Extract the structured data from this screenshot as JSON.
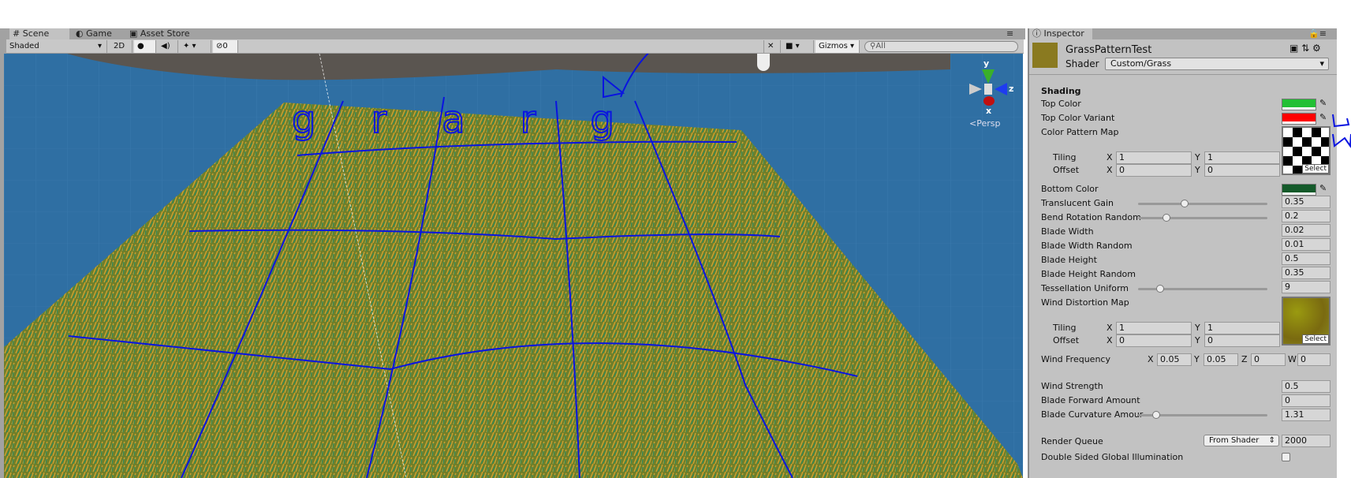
{
  "tabs": [
    {
      "label": "Scene",
      "icon": "grid-icon"
    },
    {
      "label": "Game",
      "icon": "pacman-icon"
    },
    {
      "label": "Asset Store",
      "icon": "bag-icon"
    }
  ],
  "scene_toolbar": {
    "shading_mode": "Shaded",
    "mode_2d": "2D",
    "hidden_count": "0",
    "gizmos": "Gizmos",
    "search_placeholder": "All"
  },
  "gizmo": {
    "y": "y",
    "z": "z",
    "x": "x",
    "projection": "Persp"
  },
  "annotation": {
    "letters": "grarg"
  },
  "inspector": {
    "tab": "Inspector",
    "material_name": "GrassPatternTest",
    "shader_label": "Shader",
    "shader_value": "Custom/Grass",
    "section": "Shading",
    "top_color": {
      "label": "Top Color",
      "color": "#22c034"
    },
    "top_color_variant": {
      "label": "Top Color Variant",
      "color": "#ff0000"
    },
    "color_pattern_map": {
      "label": "Color Pattern Map",
      "tiling_label": "Tiling",
      "offset_label": "Offset",
      "tiling_x": "1",
      "tiling_y": "1",
      "offset_x": "0",
      "offset_y": "0",
      "select": "Select"
    },
    "bottom_color": {
      "label": "Bottom Color",
      "color": "#145a2a"
    },
    "translucent_gain": {
      "label": "Translucent Gain",
      "value": "0.35",
      "fraction": 0.35
    },
    "bend_rotation_random": {
      "label": "Bend Rotation Random",
      "value": "0.2",
      "fraction": 0.2
    },
    "blade_width": {
      "label": "Blade Width",
      "value": "0.02"
    },
    "blade_width_random": {
      "label": "Blade Width Random",
      "value": "0.01"
    },
    "blade_height": {
      "label": "Blade Height",
      "value": "0.5"
    },
    "blade_height_random": {
      "label": "Blade Height Random",
      "value": "0.35"
    },
    "tessellation_uniform": {
      "label": "Tessellation Uniform",
      "value": "9",
      "fraction": 0.15
    },
    "wind_distortion_map": {
      "label": "Wind Distortion Map",
      "tiling_label": "Tiling",
      "offset_label": "Offset",
      "tiling_x": "1",
      "tiling_y": "1",
      "offset_x": "0",
      "offset_y": "0",
      "select": "Select"
    },
    "wind_frequency": {
      "label": "Wind Frequency",
      "x": "0.05",
      "y": "0.05",
      "z": "0",
      "w": "0"
    },
    "wind_strength": {
      "label": "Wind Strength",
      "value": "0.5"
    },
    "blade_forward_amount": {
      "label": "Blade Forward Amount",
      "value": "0"
    },
    "blade_curvature_amount": {
      "label": "Blade Curvature Amour",
      "value": "1.31",
      "fraction": 0.12
    },
    "render_queue": {
      "label": "Render Queue",
      "mode": "From Shader",
      "value": "2000"
    },
    "double_sided_gi": {
      "label": "Double Sided Global Illumination",
      "checked": false
    }
  }
}
